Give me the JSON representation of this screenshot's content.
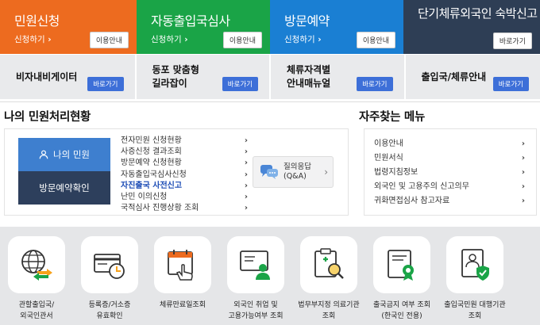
{
  "top_tiles": [
    {
      "title": "민원신청",
      "sub": "신청하기",
      "button": "이용안내",
      "color": "#ed6b1f"
    },
    {
      "title": "자동출입국심사",
      "sub": "신청하기",
      "button": "이용안내",
      "color": "#1aa447"
    },
    {
      "title": "방문예약",
      "sub": "신청하기",
      "button": "이용안내",
      "color": "#1a7fd3"
    },
    {
      "title": "단기체류외국인 숙박신고",
      "button": "바로가기",
      "color": "#2e3e55"
    }
  ],
  "gray_tiles": [
    {
      "line1": "비자내비게이터",
      "line2": "",
      "button": "바로가기"
    },
    {
      "line1": "동포 맞춤형",
      "line2": "길라잡이",
      "button": "바로가기"
    },
    {
      "line1": "체류자격별",
      "line2": "안내매뉴얼",
      "button": "바로가기"
    },
    {
      "line1": "출입국/체류안내",
      "line2": "",
      "button": "바로가기"
    }
  ],
  "status_section": {
    "title": "나의 민원처리현황",
    "my_civil_button": "나의 민원",
    "visit_check_button": "방문예약확인",
    "links": [
      "전자민원 신청현황",
      "사증신청 결과조회",
      "방문예약 신청현황",
      "자동출입국심사신청",
      "자진출국 사전신고",
      "난민 이의신청",
      "국적심사 진행상황 조회"
    ],
    "qa_label_line1": "질의응답",
    "qa_label_line2": "(Q&A)"
  },
  "faq_section": {
    "title": "자주찾는 메뉴",
    "items": [
      "이용안내",
      "민원서식",
      "법령지침정보",
      "외국인 및 고용주의 신고의무",
      "귀화면접심사 참고자료"
    ]
  },
  "bottom_icons": [
    {
      "icon": "globe-arrows-icon",
      "line1": "관할출입국/",
      "line2": "외국인관서"
    },
    {
      "icon": "card-clock-icon",
      "line1": "등록증/거소증",
      "line2": "유효확인"
    },
    {
      "icon": "calendar-hand-icon",
      "line1": "체류만료일조회",
      "line2": ""
    },
    {
      "icon": "person-screen-icon",
      "line1": "외국인 취업 및",
      "line2": "고용가능여부 조회"
    },
    {
      "icon": "clipboard-search-icon",
      "line1": "법무부지정 의료기관",
      "line2": "조회"
    },
    {
      "icon": "certificate-icon",
      "line1": "출국금지 여부 조회",
      "line2": "(한국인 전용)"
    },
    {
      "icon": "id-shield-icon",
      "line1": "출입국민원 대행기관",
      "line2": "조회"
    }
  ]
}
